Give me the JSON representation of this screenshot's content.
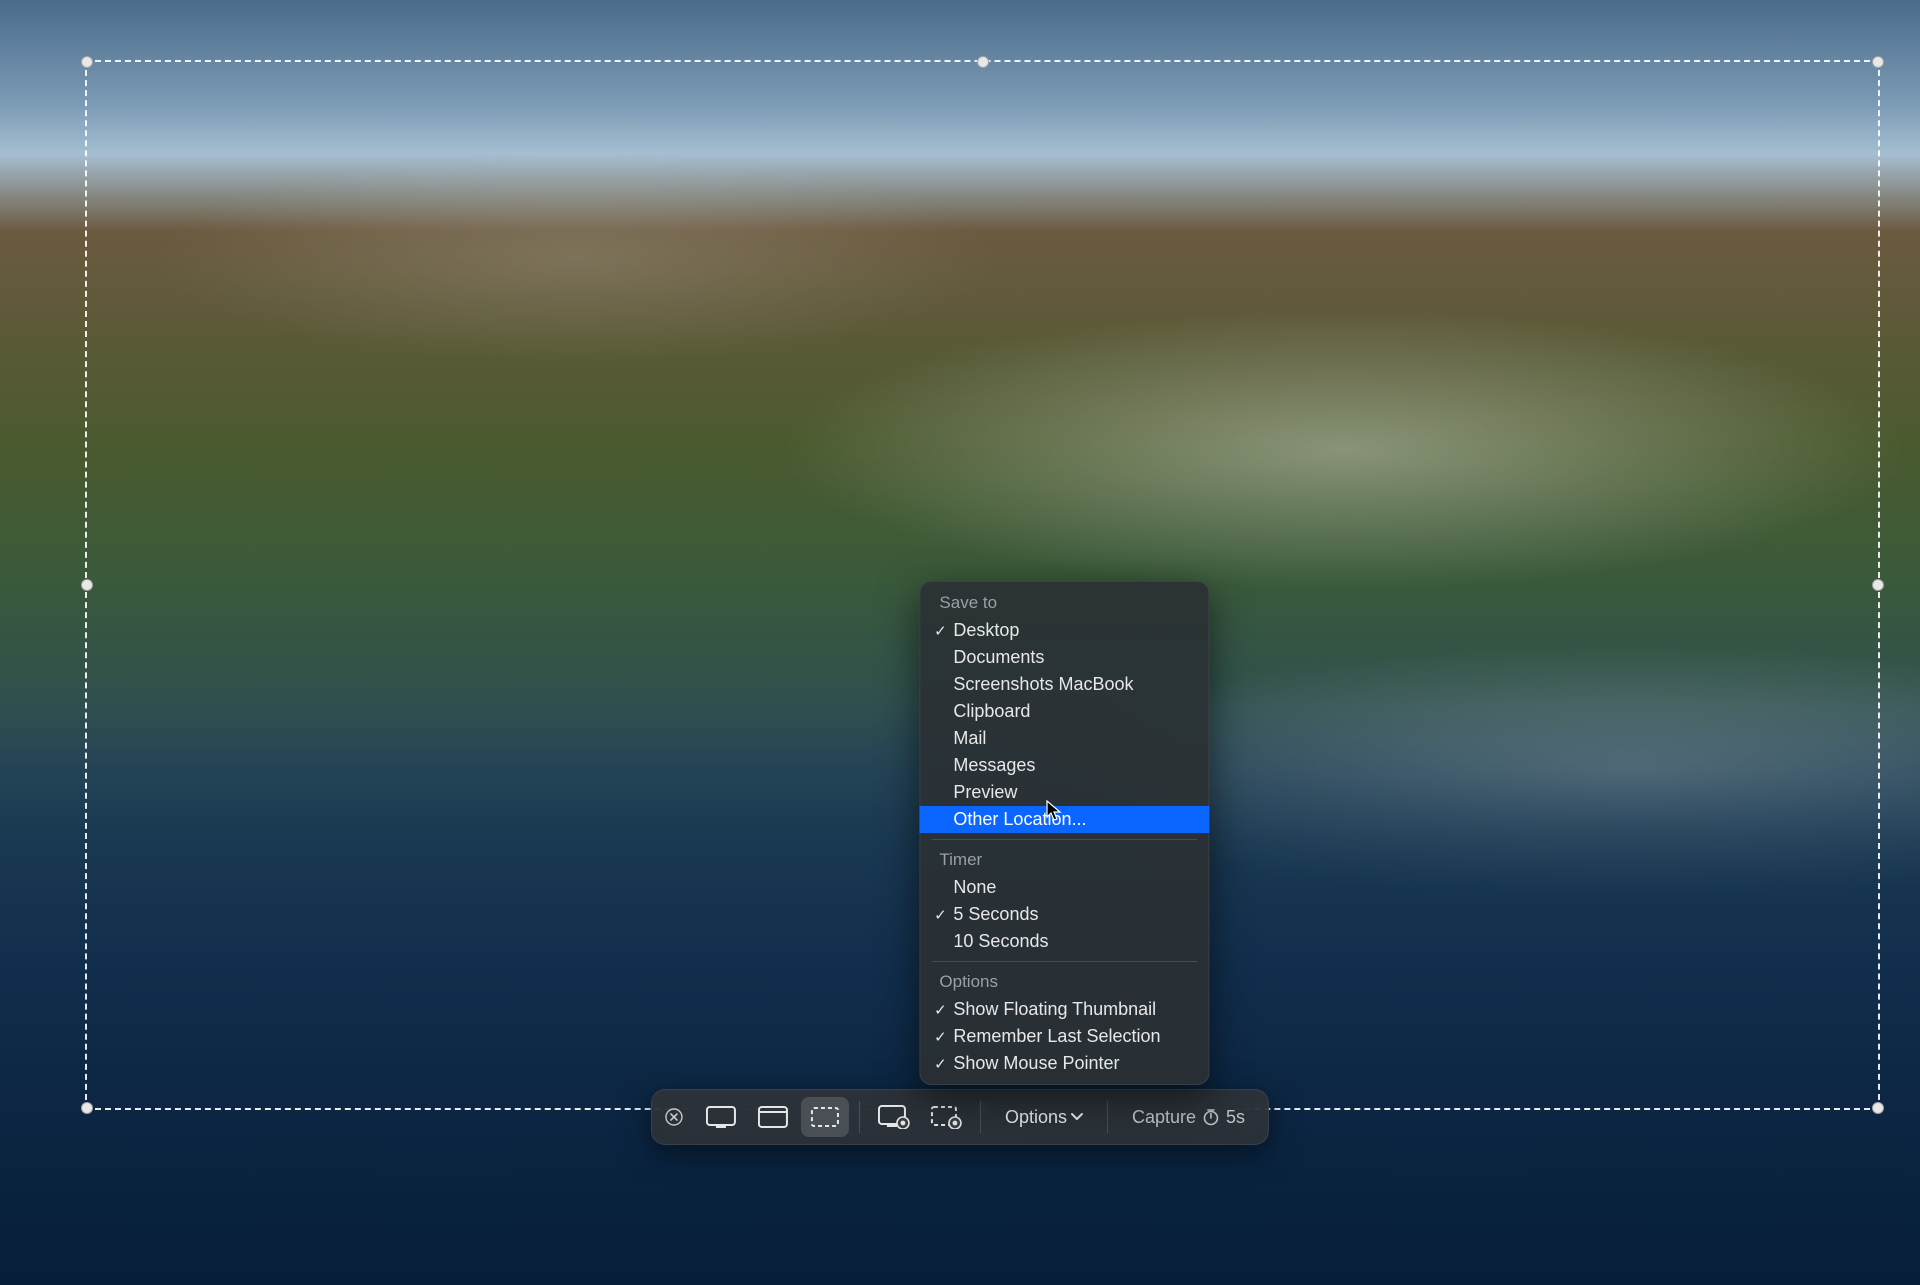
{
  "toolbar": {
    "options_label": "Options",
    "capture_label": "Capture",
    "capture_timer_label": "5s"
  },
  "menu": {
    "sections": [
      {
        "header": "Save to",
        "items": [
          {
            "label": "Desktop",
            "checked": true,
            "highlight": false
          },
          {
            "label": "Documents",
            "checked": false,
            "highlight": false
          },
          {
            "label": "Screenshots MacBook",
            "checked": false,
            "highlight": false
          },
          {
            "label": "Clipboard",
            "checked": false,
            "highlight": false
          },
          {
            "label": "Mail",
            "checked": false,
            "highlight": false
          },
          {
            "label": "Messages",
            "checked": false,
            "highlight": false
          },
          {
            "label": "Preview",
            "checked": false,
            "highlight": false
          },
          {
            "label": "Other Location...",
            "checked": false,
            "highlight": true
          }
        ]
      },
      {
        "header": "Timer",
        "items": [
          {
            "label": "None",
            "checked": false,
            "highlight": false
          },
          {
            "label": "5 Seconds",
            "checked": true,
            "highlight": false
          },
          {
            "label": "10 Seconds",
            "checked": false,
            "highlight": false
          }
        ]
      },
      {
        "header": "Options",
        "items": [
          {
            "label": "Show Floating Thumbnail",
            "checked": true,
            "highlight": false
          },
          {
            "label": "Remember Last Selection",
            "checked": true,
            "highlight": false
          },
          {
            "label": "Show Mouse Pointer",
            "checked": true,
            "highlight": false
          }
        ]
      }
    ]
  }
}
